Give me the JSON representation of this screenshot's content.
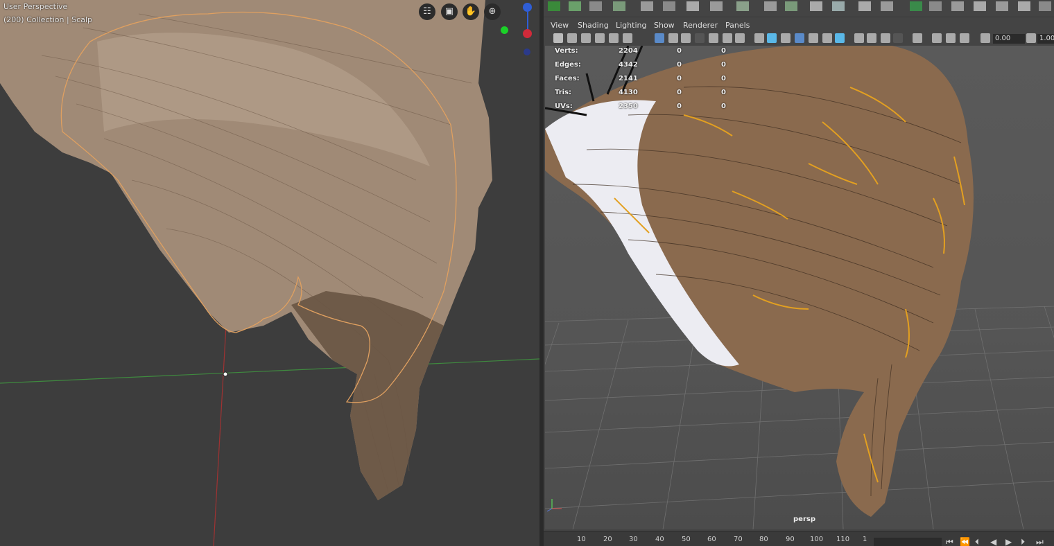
{
  "blender": {
    "view_name": "User Perspective",
    "view_info": "(200) Collection | Scalp",
    "nav_buttons": [
      {
        "name": "toggle-camera-view-icon",
        "glyph": "☷"
      },
      {
        "name": "camera-icon",
        "glyph": "▣"
      },
      {
        "name": "hand-pan-icon",
        "glyph": "✋"
      },
      {
        "name": "zoom-icon",
        "glyph": "⊕"
      }
    ]
  },
  "maya": {
    "panel_menu": [
      "View",
      "Shading",
      "Lighting",
      "Show",
      "Renderer",
      "Panels"
    ],
    "fields": {
      "exposure": "0.00",
      "gamma": "1.00"
    },
    "hud": [
      {
        "label": "Verts:",
        "value": "2204",
        "sel": "0",
        "extra": "0"
      },
      {
        "label": "Edges:",
        "value": "4342",
        "sel": "0",
        "extra": "0"
      },
      {
        "label": "Faces:",
        "value": "2141",
        "sel": "0",
        "extra": "0"
      },
      {
        "label": "Tris:",
        "value": "4130",
        "sel": "0",
        "extra": "0"
      },
      {
        "label": "UVs:",
        "value": "2350",
        "sel": "0",
        "extra": "0"
      }
    ],
    "camera_label": "persp",
    "timeline_ticks": [
      "10",
      "20",
      "30",
      "40",
      "50",
      "60",
      "70",
      "80",
      "90",
      "100",
      "110",
      "1"
    ],
    "colors": {
      "hair_blender": "#a08a76",
      "hair_maya": "#8a6a4e",
      "hair_strand": "#e3a020",
      "selection_outline": "#e0a060"
    }
  }
}
